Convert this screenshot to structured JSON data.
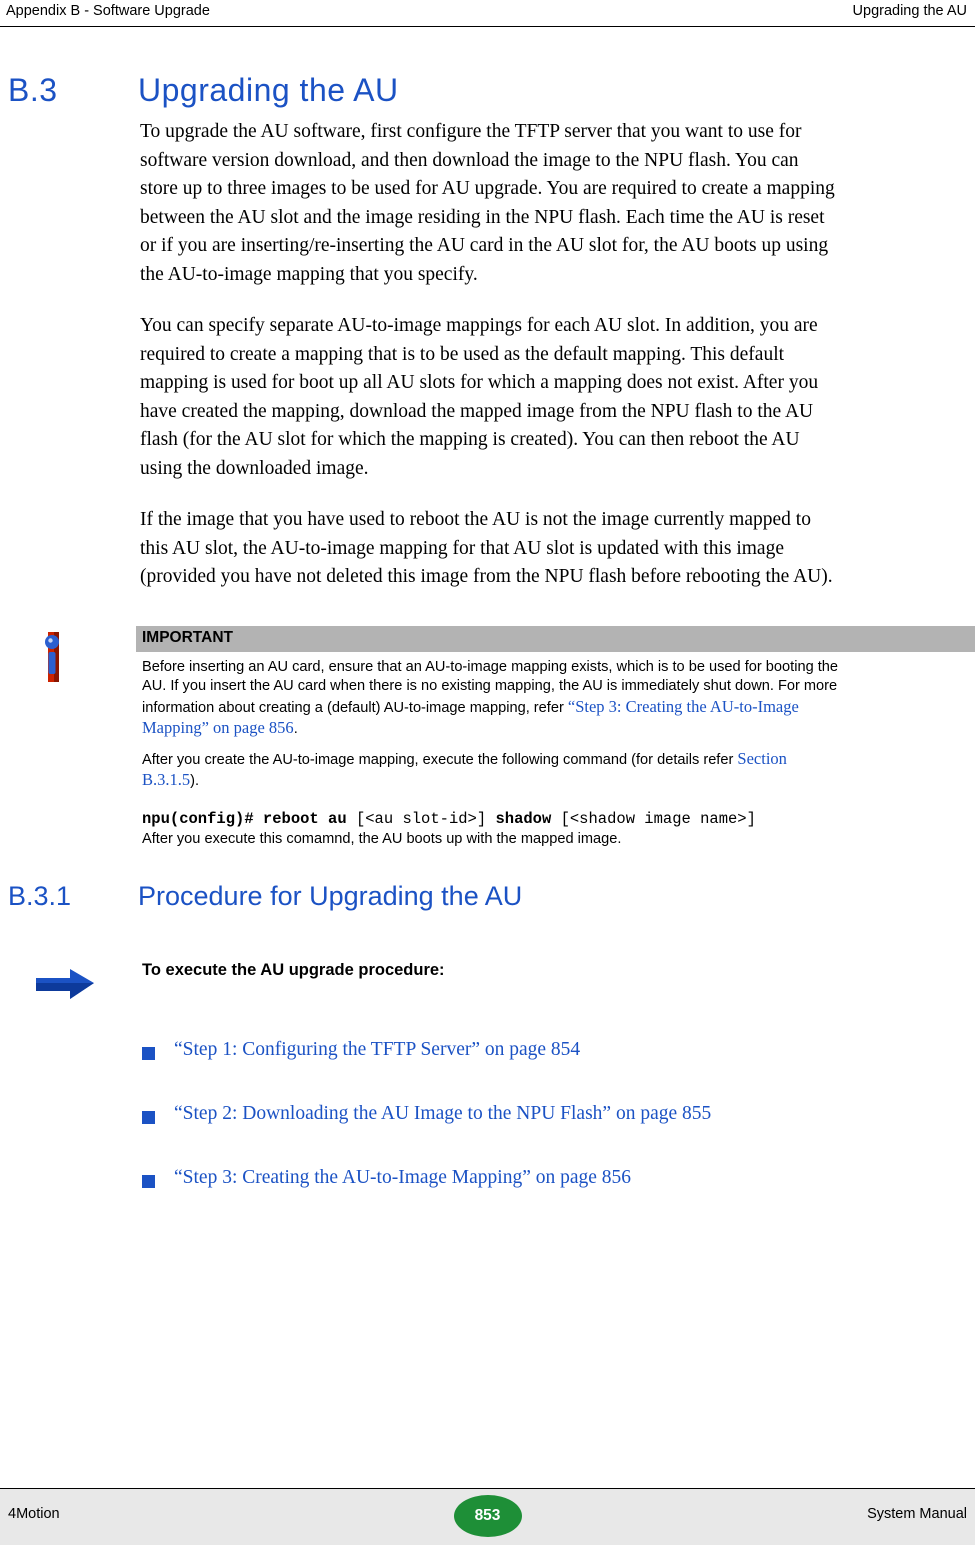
{
  "header": {
    "left": "Appendix B - Software Upgrade",
    "right": "Upgrading the AU"
  },
  "section": {
    "number": "B.3",
    "title": "Upgrading the AU"
  },
  "paragraphs": [
    "To upgrade the AU software, first configure the TFTP server that you want to use for software version download, and then download the image to the NPU flash. You can store up to three images to be used for AU upgrade. You are required to create a mapping between the AU slot and the image residing in the NPU flash. Each time the AU is reset or if you are inserting/re-inserting the AU card in the AU slot for, the AU boots up using the AU-to-image mapping that you specify.",
    "You can specify separate AU-to-image mappings for each AU slot. In addition, you are required to create a mapping that is to be used as the default mapping. This default mapping is used for boot up all AU slots for which a mapping does not exist. After you have created the mapping, download the mapped image from the NPU flash to the AU flash (for the AU slot for which the mapping is created). You can then reboot the AU using the downloaded image.",
    "If the image that you have used to reboot the AU is not the image currently mapped to this AU slot, the AU-to-image mapping for that AU slot is updated with this image (provided you have not deleted this image from the NPU flash before rebooting the AU)."
  ],
  "note": {
    "icon_name": "important-info-icon",
    "bar_label": "IMPORTANT",
    "body_1_part1": "Before inserting an AU card, ensure that  an AU-to-image mapping exists, which is to be used for booting the AU. If you insert the AU card when there is no existing mapping, the AU is immediately shut down. For more information about creating a (default) AU-to-image mapping, refer ",
    "body_1_link": "“Step 3: Creating the AU-to-Image Mapping” on page 856",
    "body_1_part2": ".",
    "body_2_part1": "After you create the AU-to-image mapping, execute the following command (for details refer ",
    "body_2_link": "Section B.3.1.5",
    "body_2_part2": ").",
    "command_bold_1": "npu(config)# reboot au",
    "command_plain_1": " [<au slot-id>] ",
    "command_bold_2": "shadow",
    "command_plain_2": " [<shadow image name>]",
    "body_3": "After you execute this comamnd, the AU boots up with the mapped image."
  },
  "subsection": {
    "number": "B.3.1",
    "title": "Procedure for Upgrading the AU"
  },
  "procedure": {
    "arrow_icon_name": "blue-arrow-icon",
    "title": "To execute the AU upgrade procedure:"
  },
  "bullets": [
    "“Step 1: Configuring the TFTP Server” on page 854",
    "“Step 2: Downloading the AU Image to the NPU Flash” on page 855",
    "“Step 3: Creating the AU-to-Image Mapping” on page 856"
  ],
  "footer": {
    "left": "4Motion",
    "page": "853",
    "right": "System Manual"
  },
  "colors": {
    "accent_blue": "#1b52c4",
    "note_bar_gray": "#b3b3b3",
    "footer_gray": "#e8e8e8",
    "page_badge_green": "#1e8f37"
  }
}
